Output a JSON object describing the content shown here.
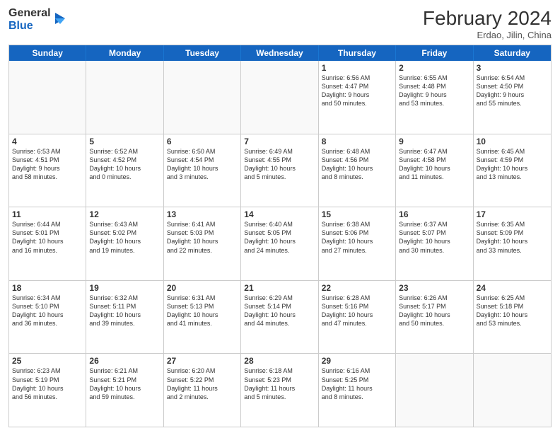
{
  "header": {
    "logo_general": "General",
    "logo_blue": "Blue",
    "month_year": "February 2024",
    "location": "Erdao, Jilin, China"
  },
  "weekdays": [
    "Sunday",
    "Monday",
    "Tuesday",
    "Wednesday",
    "Thursday",
    "Friday",
    "Saturday"
  ],
  "rows": [
    [
      {
        "day": "",
        "info": ""
      },
      {
        "day": "",
        "info": ""
      },
      {
        "day": "",
        "info": ""
      },
      {
        "day": "",
        "info": ""
      },
      {
        "day": "1",
        "info": "Sunrise: 6:56 AM\nSunset: 4:47 PM\nDaylight: 9 hours\nand 50 minutes."
      },
      {
        "day": "2",
        "info": "Sunrise: 6:55 AM\nSunset: 4:48 PM\nDaylight: 9 hours\nand 53 minutes."
      },
      {
        "day": "3",
        "info": "Sunrise: 6:54 AM\nSunset: 4:50 PM\nDaylight: 9 hours\nand 55 minutes."
      }
    ],
    [
      {
        "day": "4",
        "info": "Sunrise: 6:53 AM\nSunset: 4:51 PM\nDaylight: 9 hours\nand 58 minutes."
      },
      {
        "day": "5",
        "info": "Sunrise: 6:52 AM\nSunset: 4:52 PM\nDaylight: 10 hours\nand 0 minutes."
      },
      {
        "day": "6",
        "info": "Sunrise: 6:50 AM\nSunset: 4:54 PM\nDaylight: 10 hours\nand 3 minutes."
      },
      {
        "day": "7",
        "info": "Sunrise: 6:49 AM\nSunset: 4:55 PM\nDaylight: 10 hours\nand 5 minutes."
      },
      {
        "day": "8",
        "info": "Sunrise: 6:48 AM\nSunset: 4:56 PM\nDaylight: 10 hours\nand 8 minutes."
      },
      {
        "day": "9",
        "info": "Sunrise: 6:47 AM\nSunset: 4:58 PM\nDaylight: 10 hours\nand 11 minutes."
      },
      {
        "day": "10",
        "info": "Sunrise: 6:45 AM\nSunset: 4:59 PM\nDaylight: 10 hours\nand 13 minutes."
      }
    ],
    [
      {
        "day": "11",
        "info": "Sunrise: 6:44 AM\nSunset: 5:01 PM\nDaylight: 10 hours\nand 16 minutes."
      },
      {
        "day": "12",
        "info": "Sunrise: 6:43 AM\nSunset: 5:02 PM\nDaylight: 10 hours\nand 19 minutes."
      },
      {
        "day": "13",
        "info": "Sunrise: 6:41 AM\nSunset: 5:03 PM\nDaylight: 10 hours\nand 22 minutes."
      },
      {
        "day": "14",
        "info": "Sunrise: 6:40 AM\nSunset: 5:05 PM\nDaylight: 10 hours\nand 24 minutes."
      },
      {
        "day": "15",
        "info": "Sunrise: 6:38 AM\nSunset: 5:06 PM\nDaylight: 10 hours\nand 27 minutes."
      },
      {
        "day": "16",
        "info": "Sunrise: 6:37 AM\nSunset: 5:07 PM\nDaylight: 10 hours\nand 30 minutes."
      },
      {
        "day": "17",
        "info": "Sunrise: 6:35 AM\nSunset: 5:09 PM\nDaylight: 10 hours\nand 33 minutes."
      }
    ],
    [
      {
        "day": "18",
        "info": "Sunrise: 6:34 AM\nSunset: 5:10 PM\nDaylight: 10 hours\nand 36 minutes."
      },
      {
        "day": "19",
        "info": "Sunrise: 6:32 AM\nSunset: 5:11 PM\nDaylight: 10 hours\nand 39 minutes."
      },
      {
        "day": "20",
        "info": "Sunrise: 6:31 AM\nSunset: 5:13 PM\nDaylight: 10 hours\nand 41 minutes."
      },
      {
        "day": "21",
        "info": "Sunrise: 6:29 AM\nSunset: 5:14 PM\nDaylight: 10 hours\nand 44 minutes."
      },
      {
        "day": "22",
        "info": "Sunrise: 6:28 AM\nSunset: 5:16 PM\nDaylight: 10 hours\nand 47 minutes."
      },
      {
        "day": "23",
        "info": "Sunrise: 6:26 AM\nSunset: 5:17 PM\nDaylight: 10 hours\nand 50 minutes."
      },
      {
        "day": "24",
        "info": "Sunrise: 6:25 AM\nSunset: 5:18 PM\nDaylight: 10 hours\nand 53 minutes."
      }
    ],
    [
      {
        "day": "25",
        "info": "Sunrise: 6:23 AM\nSunset: 5:19 PM\nDaylight: 10 hours\nand 56 minutes."
      },
      {
        "day": "26",
        "info": "Sunrise: 6:21 AM\nSunset: 5:21 PM\nDaylight: 10 hours\nand 59 minutes."
      },
      {
        "day": "27",
        "info": "Sunrise: 6:20 AM\nSunset: 5:22 PM\nDaylight: 11 hours\nand 2 minutes."
      },
      {
        "day": "28",
        "info": "Sunrise: 6:18 AM\nSunset: 5:23 PM\nDaylight: 11 hours\nand 5 minutes."
      },
      {
        "day": "29",
        "info": "Sunrise: 6:16 AM\nSunset: 5:25 PM\nDaylight: 11 hours\nand 8 minutes."
      },
      {
        "day": "",
        "info": ""
      },
      {
        "day": "",
        "info": ""
      }
    ]
  ]
}
